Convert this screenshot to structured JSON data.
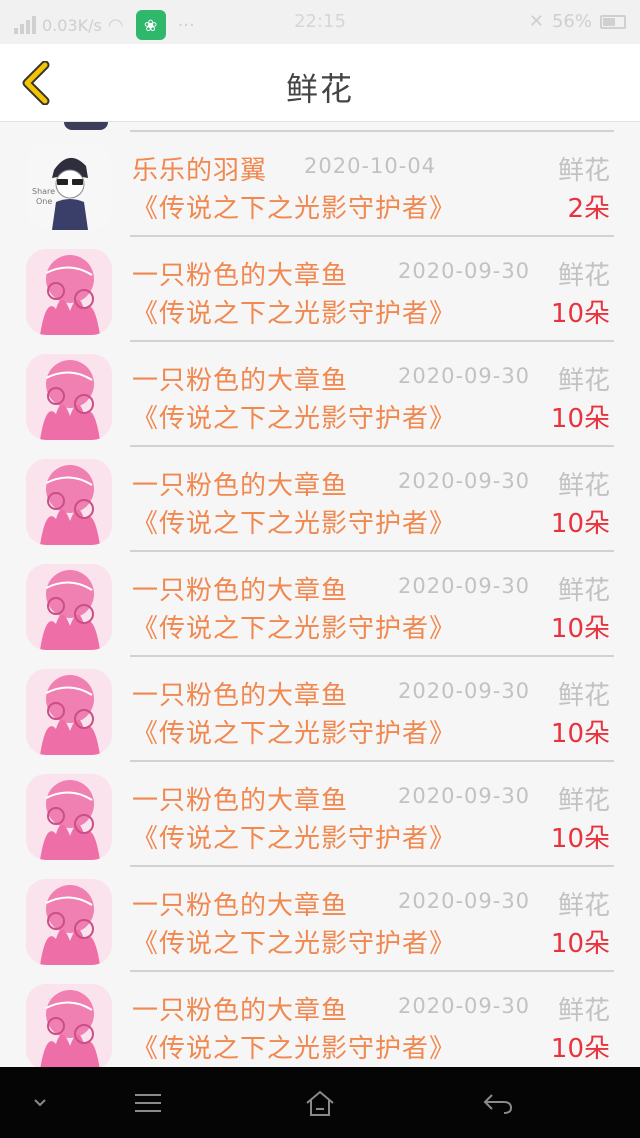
{
  "status_bar": {
    "speed": "0.03K/s",
    "time": "22:15",
    "battery": "56%",
    "app_icon": "app-icon"
  },
  "header": {
    "title": "鲜花"
  },
  "rows": [
    {
      "name": "乐乐的羽翼",
      "date": "2020-10-04",
      "book": "《传说之下之光影守护者》",
      "gift": "鲜花",
      "count": "2朵",
      "avatar": "boy-sketch"
    },
    {
      "name": "一只粉色的大章鱼",
      "date": "2020-09-30",
      "book": "《传说之下之光影守护者》",
      "gift": "鲜花",
      "count": "10朵",
      "avatar": "pink-octopus"
    },
    {
      "name": "一只粉色的大章鱼",
      "date": "2020-09-30",
      "book": "《传说之下之光影守护者》",
      "gift": "鲜花",
      "count": "10朵",
      "avatar": "pink-octopus"
    },
    {
      "name": "一只粉色的大章鱼",
      "date": "2020-09-30",
      "book": "《传说之下之光影守护者》",
      "gift": "鲜花",
      "count": "10朵",
      "avatar": "pink-octopus"
    },
    {
      "name": "一只粉色的大章鱼",
      "date": "2020-09-30",
      "book": "《传说之下之光影守护者》",
      "gift": "鲜花",
      "count": "10朵",
      "avatar": "pink-octopus"
    },
    {
      "name": "一只粉色的大章鱼",
      "date": "2020-09-30",
      "book": "《传说之下之光影守护者》",
      "gift": "鲜花",
      "count": "10朵",
      "avatar": "pink-octopus"
    },
    {
      "name": "一只粉色的大章鱼",
      "date": "2020-09-30",
      "book": "《传说之下之光影守护者》",
      "gift": "鲜花",
      "count": "10朵",
      "avatar": "pink-octopus"
    },
    {
      "name": "一只粉色的大章鱼",
      "date": "2020-09-30",
      "book": "《传说之下之光影守护者》",
      "gift": "鲜花",
      "count": "10朵",
      "avatar": "pink-octopus"
    },
    {
      "name": "一只粉色的大章鱼",
      "date": "2020-09-30",
      "book": "《传说之下之光影守护者》",
      "gift": "鲜花",
      "count": "10朵",
      "avatar": "pink-octopus"
    }
  ],
  "colors": {
    "name": "#f08850",
    "count": "#e8333f",
    "muted": "#c2c2c2",
    "back_arrow": "#f5c400"
  },
  "nav_icons": [
    "chevron-down-icon",
    "menu-icon",
    "home-icon",
    "back-arrow-icon"
  ]
}
